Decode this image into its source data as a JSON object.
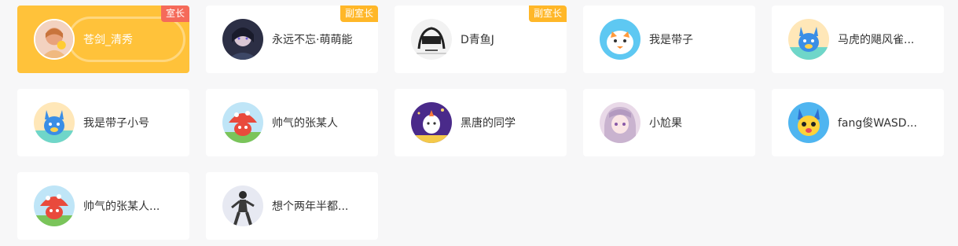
{
  "members": [
    {
      "name": "苍剑_清秀",
      "badge": "室长",
      "badge_type": "owner",
      "active": true,
      "avatar_icon": "girl-avatar-icon"
    },
    {
      "name": "永远不忘·萌萌能",
      "badge": "副室长",
      "badge_type": "vice",
      "avatar_icon": "dark-anime-avatar-icon"
    },
    {
      "name": "D青鱼J",
      "badge": "副室长",
      "badge_type": "vice",
      "avatar_icon": "sketch-avatar-icon"
    },
    {
      "name": "我是带子",
      "avatar_icon": "bird-mascot-avatar-icon"
    },
    {
      "name": "马虎的飓风雀...",
      "avatar_icon": "blue-creature-avatar-icon"
    },
    {
      "name": "我是带子小号",
      "avatar_icon": "blue-creature-avatar-icon"
    },
    {
      "name": "帅气的张某人",
      "avatar_icon": "red-mushroom-avatar-icon"
    },
    {
      "name": "黑唐的同学",
      "avatar_icon": "purple-night-avatar-icon"
    },
    {
      "name": "小尬果",
      "avatar_icon": "anime-girl-avatar-icon"
    },
    {
      "name": "fang俊WASD...",
      "avatar_icon": "yellow-creature-avatar-icon"
    },
    {
      "name": "帅气的张某人...",
      "avatar_icon": "red-mushroom-avatar-icon"
    },
    {
      "name": "想个两年半都...",
      "avatar_icon": "dancer-avatar-icon"
    }
  ],
  "colors": {
    "active_card": "#ffc23a",
    "owner_badge": "#f56a5a",
    "vice_badge": "#ffb728"
  }
}
